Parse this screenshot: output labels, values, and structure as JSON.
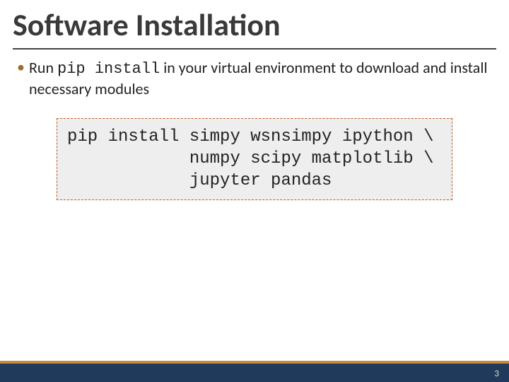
{
  "title": "Software Installation",
  "bullet": {
    "prefix": "Run ",
    "code": "pip install",
    "suffix": " in your virtual environment to download and install necessary modules"
  },
  "code_block": "pip install simpy wsnsimpy ipython \\\n            numpy scipy matplotlib \\\n            jupyter pandas",
  "page_number": "3"
}
